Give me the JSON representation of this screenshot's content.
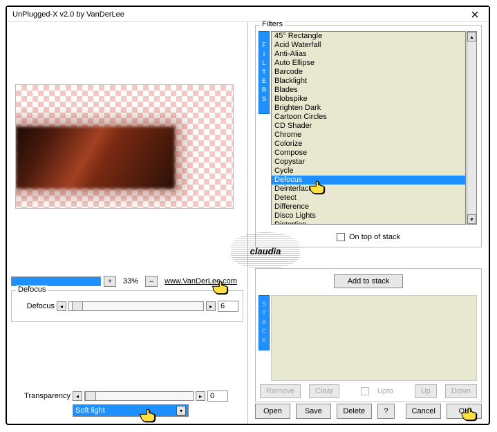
{
  "window": {
    "title": "UnPlugged-X v2.0 by VanDerLee"
  },
  "zoom": {
    "plus": "+",
    "minus": "–",
    "percent": "33%",
    "link": "www.VanDerLee.com"
  },
  "defocus": {
    "group_label": "Defocus",
    "slider_label": "Defocus",
    "value": "6"
  },
  "transparency": {
    "label": "Transparency",
    "value": "0"
  },
  "blend": {
    "selected": "Soft light"
  },
  "filters": {
    "group_label": "Filters",
    "vtab": "FILTERS",
    "items": [
      "45° Rectangle",
      "Acid Waterfall",
      "Anti-Alias",
      "Auto Ellipse",
      "Barcode",
      "Blacklight",
      "Blades",
      "Blobspike",
      "Brighten Dark",
      "Cartoon Circles",
      "CD Shader",
      "Chrome",
      "Colorize",
      "Compose",
      "Copystar",
      "Cycle",
      "Defocus",
      "Deinterlace",
      "Detect",
      "Difference",
      "Disco Lights",
      "Distortion"
    ],
    "selected_index": 16,
    "ontop_label": "On top of stack"
  },
  "stack": {
    "vtab": "STACK",
    "add_label": "Add to stack",
    "remove": "Remove",
    "clear": "Clear",
    "upto": "Upto",
    "up": "Up",
    "down": "Down"
  },
  "buttons": {
    "open": "Open",
    "save": "Save",
    "delete": "Delete",
    "help": "?",
    "cancel": "Cancel",
    "ok": "OK"
  },
  "watermark": "claudia"
}
